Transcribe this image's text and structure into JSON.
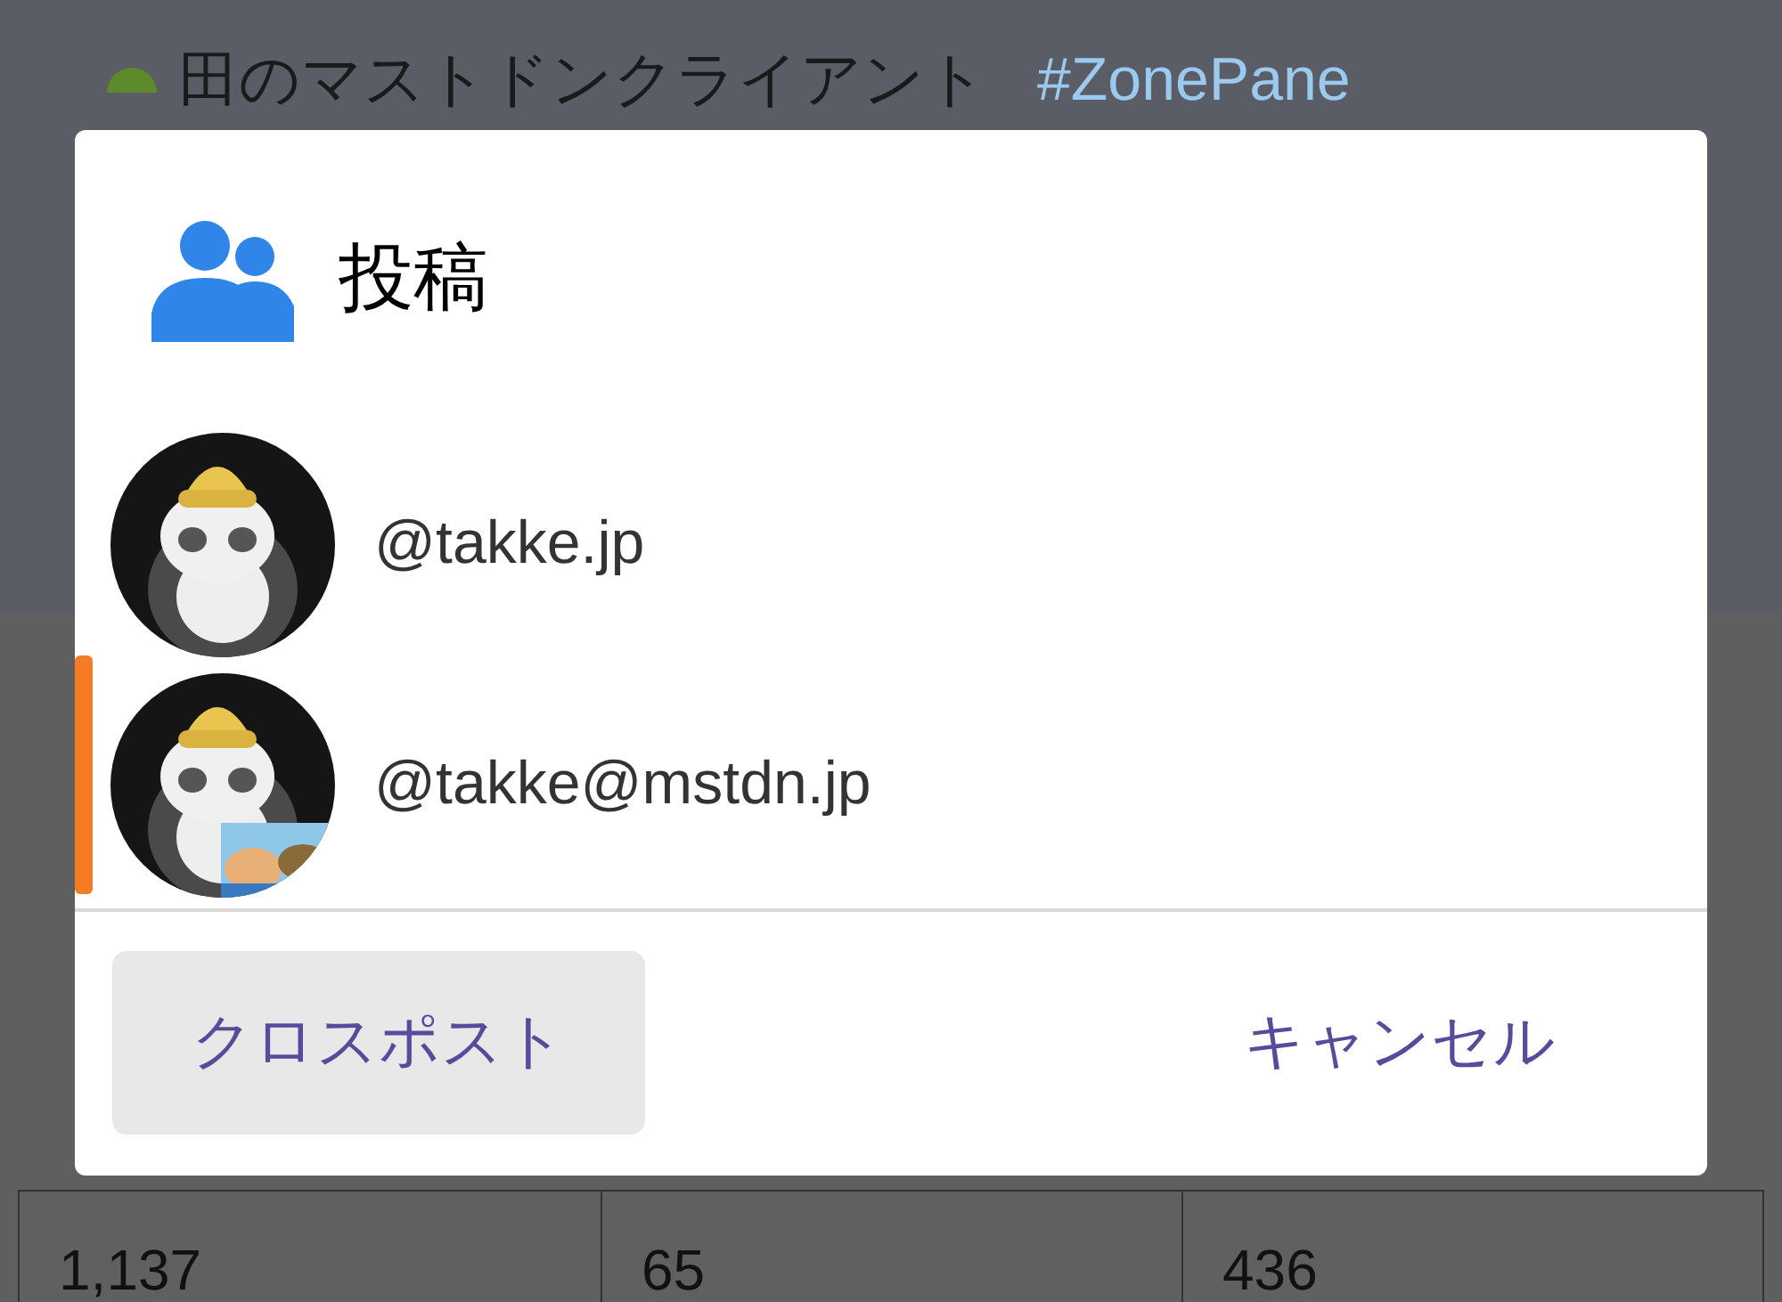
{
  "background": {
    "post_text": "田のマストドンクライアント",
    "hashtag": "#ZonePane",
    "table_row": [
      "1,137",
      "65",
      "436"
    ]
  },
  "dialog": {
    "title": "投稿",
    "accounts": [
      {
        "handle": "@takke.jp",
        "selected": false,
        "badge": false
      },
      {
        "handle": "@takke@mstdn.jp",
        "selected": true,
        "badge": true
      }
    ],
    "buttons": [
      {
        "label": "クロスポスト",
        "kind": "filled"
      },
      {
        "label": "キャンセル",
        "kind": "text"
      }
    ]
  }
}
